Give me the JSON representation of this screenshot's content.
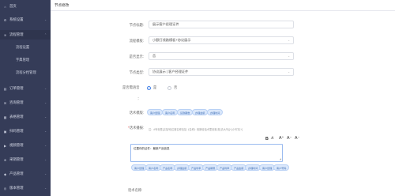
{
  "sidebar": {
    "items": [
      {
        "label": "首页",
        "icon": "home-icon",
        "glyph": "⌂"
      },
      {
        "label": "系统设置",
        "icon": "gear-icon",
        "glyph": "⚙"
      },
      {
        "label": "流程管理",
        "icon": "flow-icon",
        "glyph": "≋"
      },
      {
        "label": "订单管理",
        "icon": "order-icon",
        "glyph": "▤"
      },
      {
        "label": "咨询管理",
        "icon": "chat-icon",
        "glyph": "✉"
      },
      {
        "label": "表格管理",
        "icon": "table-icon",
        "glyph": "▦"
      },
      {
        "label": "扫码管理",
        "icon": "qr-icon",
        "glyph": "▣"
      },
      {
        "label": "视频管理",
        "icon": "video-icon",
        "glyph": "▶"
      },
      {
        "label": "采销管理",
        "icon": "cart-icon",
        "glyph": "⊕"
      },
      {
        "label": "产品管理",
        "icon": "product-icon",
        "glyph": "◆"
      },
      {
        "label": "版本管理",
        "icon": "version-icon",
        "glyph": "◎"
      }
    ],
    "sub_items": [
      "流程设置",
      "字典管理",
      "流程分档管理"
    ]
  },
  "header": {
    "title": "节点修改"
  },
  "form": {
    "node_title_label": "节点标题:",
    "node_title_value": "展示客户经理证件",
    "flow_template_label": "流程模板:",
    "flow_template_value": "小额打线路模板+协议展示",
    "is_display_label": "是否显示:",
    "is_display_value": "否",
    "node_type_label": "节点类型:",
    "node_type_value": "协议展示 | 客户经理证件",
    "need_tts_label": "是否需语音",
    "need_tts_suffix": "：",
    "radio_yes": "是",
    "radio_no": "否",
    "required_mark": "*",
    "var_label": "话术模版:",
    "speech_label": "话术播报:",
    "speech_hint": "注：#号标签[尖括号]位置名称包括《名称》用新增话术里设置,英(请大写)[+]小写字[+]",
    "editor_text": "位置你的证件：最新产品信息",
    "template_name_label": "话术名称:"
  },
  "template_chips": [
    "客户经理",
    "客户名称",
    "贷款期数",
    "办理金额",
    "办理时间"
  ],
  "speech_chips": [
    "客户经理",
    "客户名称",
    "产品名称",
    "办理金额",
    "产品利率",
    "产品期限",
    "产品利率",
    "产品金额",
    "办理时间",
    "客户经理",
    "客户号码"
  ],
  "toolbar": {
    "bold": "B",
    "italic": "A",
    "font_up": "A⁺",
    "font_down": "A⁻",
    "clear": "A⁻"
  },
  "colors": {
    "sidebar": "#353c58",
    "accent": "#3f7ee8",
    "chip_bg": "#dbe8fb"
  }
}
